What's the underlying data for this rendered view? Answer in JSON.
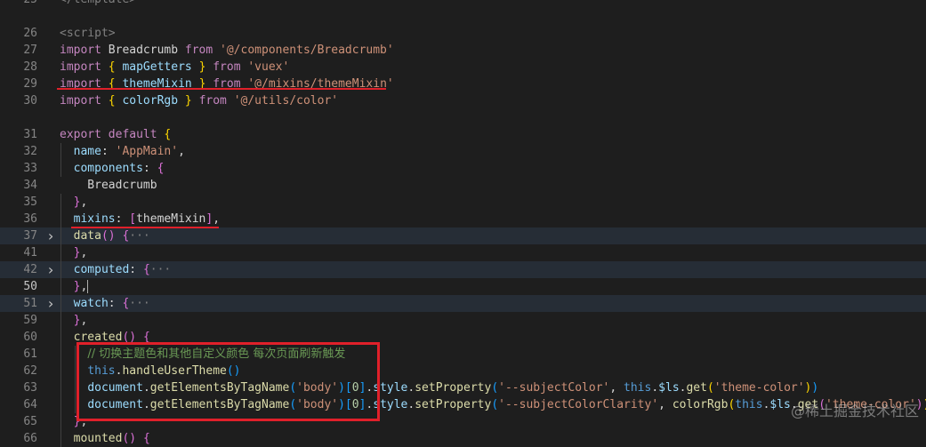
{
  "editor": {
    "lines": [
      {
        "n": "25",
        "tokens": [
          [
            "tag",
            "</template>"
          ]
        ]
      },
      {
        "n": "",
        "tokens": []
      },
      {
        "n": "26",
        "tokens": [
          [
            "tag",
            "<script>"
          ]
        ]
      },
      {
        "n": "27",
        "tokens": [
          [
            "kw",
            "import"
          ],
          [
            "plain",
            " Breadcrumb "
          ],
          [
            "kw",
            "from"
          ],
          [
            "plain",
            " "
          ],
          [
            "str",
            "'@/components/Breadcrumb'"
          ]
        ]
      },
      {
        "n": "28",
        "tokens": [
          [
            "kw",
            "import"
          ],
          [
            "plain",
            " "
          ],
          [
            "brk",
            "{"
          ],
          [
            "plain",
            " "
          ],
          [
            "var",
            "mapGetters"
          ],
          [
            "plain",
            " "
          ],
          [
            "brk",
            "}"
          ],
          [
            "plain",
            " "
          ],
          [
            "kw",
            "from"
          ],
          [
            "plain",
            " "
          ],
          [
            "str",
            "'vuex'"
          ]
        ]
      },
      {
        "n": "29",
        "tokens": [
          [
            "kw",
            "import"
          ],
          [
            "plain",
            " "
          ],
          [
            "brk",
            "{"
          ],
          [
            "plain",
            " "
          ],
          [
            "var",
            "themeMixin"
          ],
          [
            "plain",
            " "
          ],
          [
            "brk",
            "}"
          ],
          [
            "plain",
            " "
          ],
          [
            "kw",
            "from"
          ],
          [
            "plain",
            " "
          ],
          [
            "str",
            "'@/mixins/themeMixin'"
          ]
        ]
      },
      {
        "n": "30",
        "tokens": [
          [
            "kw",
            "import"
          ],
          [
            "plain",
            " "
          ],
          [
            "brk",
            "{"
          ],
          [
            "plain",
            " "
          ],
          [
            "var",
            "colorRgb"
          ],
          [
            "plain",
            " "
          ],
          [
            "brk",
            "}"
          ],
          [
            "plain",
            " "
          ],
          [
            "kw",
            "from"
          ],
          [
            "plain",
            " "
          ],
          [
            "str",
            "'@/utils/color'"
          ]
        ]
      },
      {
        "n": "",
        "tokens": []
      },
      {
        "n": "31",
        "tokens": [
          [
            "kw",
            "export"
          ],
          [
            "plain",
            " "
          ],
          [
            "kw",
            "default"
          ],
          [
            "plain",
            " "
          ],
          [
            "brk",
            "{"
          ]
        ]
      },
      {
        "n": "32",
        "tokens": [
          [
            "plain",
            "  "
          ],
          [
            "var",
            "name"
          ],
          [
            "plain",
            ": "
          ],
          [
            "str",
            "'AppMain'"
          ],
          [
            "plain",
            ","
          ]
        ]
      },
      {
        "n": "33",
        "tokens": [
          [
            "plain",
            "  "
          ],
          [
            "var",
            "components"
          ],
          [
            "plain",
            ": "
          ],
          [
            "brk2",
            "{"
          ]
        ]
      },
      {
        "n": "34",
        "tokens": [
          [
            "plain",
            "    Breadcrumb"
          ]
        ]
      },
      {
        "n": "35",
        "tokens": [
          [
            "plain",
            "  "
          ],
          [
            "brk2",
            "}"
          ],
          [
            "plain",
            ","
          ]
        ]
      },
      {
        "n": "36",
        "tokens": [
          [
            "plain",
            "  "
          ],
          [
            "var",
            "mixins"
          ],
          [
            "plain",
            ": "
          ],
          [
            "brk2",
            "["
          ],
          [
            "plain",
            "themeMixin"
          ],
          [
            "brk2",
            "]"
          ],
          [
            "plain",
            ","
          ]
        ]
      },
      {
        "n": "37",
        "fold": true,
        "hl": true,
        "tokens": [
          [
            "plain",
            "  "
          ],
          [
            "fn",
            "data"
          ],
          [
            "brk2",
            "()"
          ],
          [
            "plain",
            " "
          ],
          [
            "brk2",
            "{"
          ],
          [
            "dim",
            "···"
          ]
        ]
      },
      {
        "n": "41",
        "tokens": [
          [
            "plain",
            "  "
          ],
          [
            "brk2",
            "}"
          ],
          [
            "plain",
            ","
          ]
        ]
      },
      {
        "n": "42",
        "fold": true,
        "hl": true,
        "tokens": [
          [
            "plain",
            "  "
          ],
          [
            "var",
            "computed"
          ],
          [
            "plain",
            ": "
          ],
          [
            "brk2",
            "{"
          ],
          [
            "dim",
            "···"
          ]
        ]
      },
      {
        "n": "50",
        "cur": true,
        "tokens": [
          [
            "plain",
            "  "
          ],
          [
            "brk2",
            "}"
          ],
          [
            "plain",
            ","
          ],
          [
            "caret",
            ""
          ]
        ]
      },
      {
        "n": "51",
        "fold": true,
        "hl": true,
        "tokens": [
          [
            "plain",
            "  "
          ],
          [
            "var",
            "watch"
          ],
          [
            "plain",
            ": "
          ],
          [
            "brk2",
            "{"
          ],
          [
            "dim",
            "···"
          ]
        ]
      },
      {
        "n": "59",
        "tokens": [
          [
            "plain",
            "  "
          ],
          [
            "brk2",
            "}"
          ],
          [
            "plain",
            ","
          ]
        ]
      },
      {
        "n": "60",
        "tokens": [
          [
            "plain",
            "  "
          ],
          [
            "fn",
            "created"
          ],
          [
            "brk2",
            "()"
          ],
          [
            "plain",
            " "
          ],
          [
            "brk2",
            "{"
          ]
        ]
      },
      {
        "n": "61",
        "tokens": [
          [
            "plain",
            "    "
          ],
          [
            "cmt",
            "// 切换主题色和其他自定义颜色 每次页面刷新触发"
          ]
        ]
      },
      {
        "n": "62",
        "tokens": [
          [
            "plain",
            "    "
          ],
          [
            "kw2",
            "this"
          ],
          [
            "plain",
            "."
          ],
          [
            "fn",
            "handleUserTheme"
          ],
          [
            "brk3",
            "()"
          ]
        ]
      },
      {
        "n": "63",
        "tokens": [
          [
            "plain",
            "    "
          ],
          [
            "var",
            "document"
          ],
          [
            "plain",
            "."
          ],
          [
            "fn",
            "getElementsByTagName"
          ],
          [
            "brk3",
            "("
          ],
          [
            "str",
            "'body'"
          ],
          [
            "brk3",
            ")"
          ],
          [
            "brk3",
            "["
          ],
          [
            "num",
            "0"
          ],
          [
            "brk3",
            "]"
          ],
          [
            "plain",
            "."
          ],
          [
            "var",
            "style"
          ],
          [
            "plain",
            "."
          ],
          [
            "fn",
            "setProperty"
          ],
          [
            "brk3",
            "("
          ],
          [
            "str",
            "'--subjectColor'"
          ],
          [
            "plain",
            ", "
          ],
          [
            "kw2",
            "this"
          ],
          [
            "plain",
            "."
          ],
          [
            "var",
            "$ls"
          ],
          [
            "plain",
            "."
          ],
          [
            "fn",
            "get"
          ],
          [
            "brk",
            "("
          ],
          [
            "str",
            "'theme-color'"
          ],
          [
            "brk",
            ")"
          ],
          [
            "brk3",
            ")"
          ]
        ]
      },
      {
        "n": "64",
        "tokens": [
          [
            "plain",
            "    "
          ],
          [
            "var",
            "document"
          ],
          [
            "plain",
            "."
          ],
          [
            "fn",
            "getElementsByTagName"
          ],
          [
            "brk3",
            "("
          ],
          [
            "str",
            "'body'"
          ],
          [
            "brk3",
            ")"
          ],
          [
            "brk3",
            "["
          ],
          [
            "num",
            "0"
          ],
          [
            "brk3",
            "]"
          ],
          [
            "plain",
            "."
          ],
          [
            "var",
            "style"
          ],
          [
            "plain",
            "."
          ],
          [
            "fn",
            "setProperty"
          ],
          [
            "brk3",
            "("
          ],
          [
            "str",
            "'--subjectColorClarity'"
          ],
          [
            "plain",
            ", "
          ],
          [
            "fn",
            "colorRgb"
          ],
          [
            "brk",
            "("
          ],
          [
            "kw2",
            "this"
          ],
          [
            "plain",
            "."
          ],
          [
            "var",
            "$ls"
          ],
          [
            "plain",
            "."
          ],
          [
            "fn",
            "get"
          ],
          [
            "brk2",
            "("
          ],
          [
            "str",
            "'theme-color'"
          ],
          [
            "brk2",
            ")"
          ],
          [
            "brk",
            ")"
          ],
          [
            "brk3",
            ")"
          ]
        ]
      },
      {
        "n": "65",
        "tokens": [
          [
            "plain",
            "  "
          ],
          [
            "brk2",
            "}"
          ],
          [
            "plain",
            ","
          ]
        ]
      },
      {
        "n": "66",
        "tokens": [
          [
            "plain",
            "  "
          ],
          [
            "fn",
            "mounted"
          ],
          [
            "brk2",
            "()"
          ],
          [
            "plain",
            " "
          ],
          [
            "brk2",
            "{"
          ]
        ]
      }
    ]
  },
  "watermark": "@稀土掘金技术社区",
  "colors": {
    "annotation": "#e0202a",
    "background": "#1e1e1e"
  }
}
